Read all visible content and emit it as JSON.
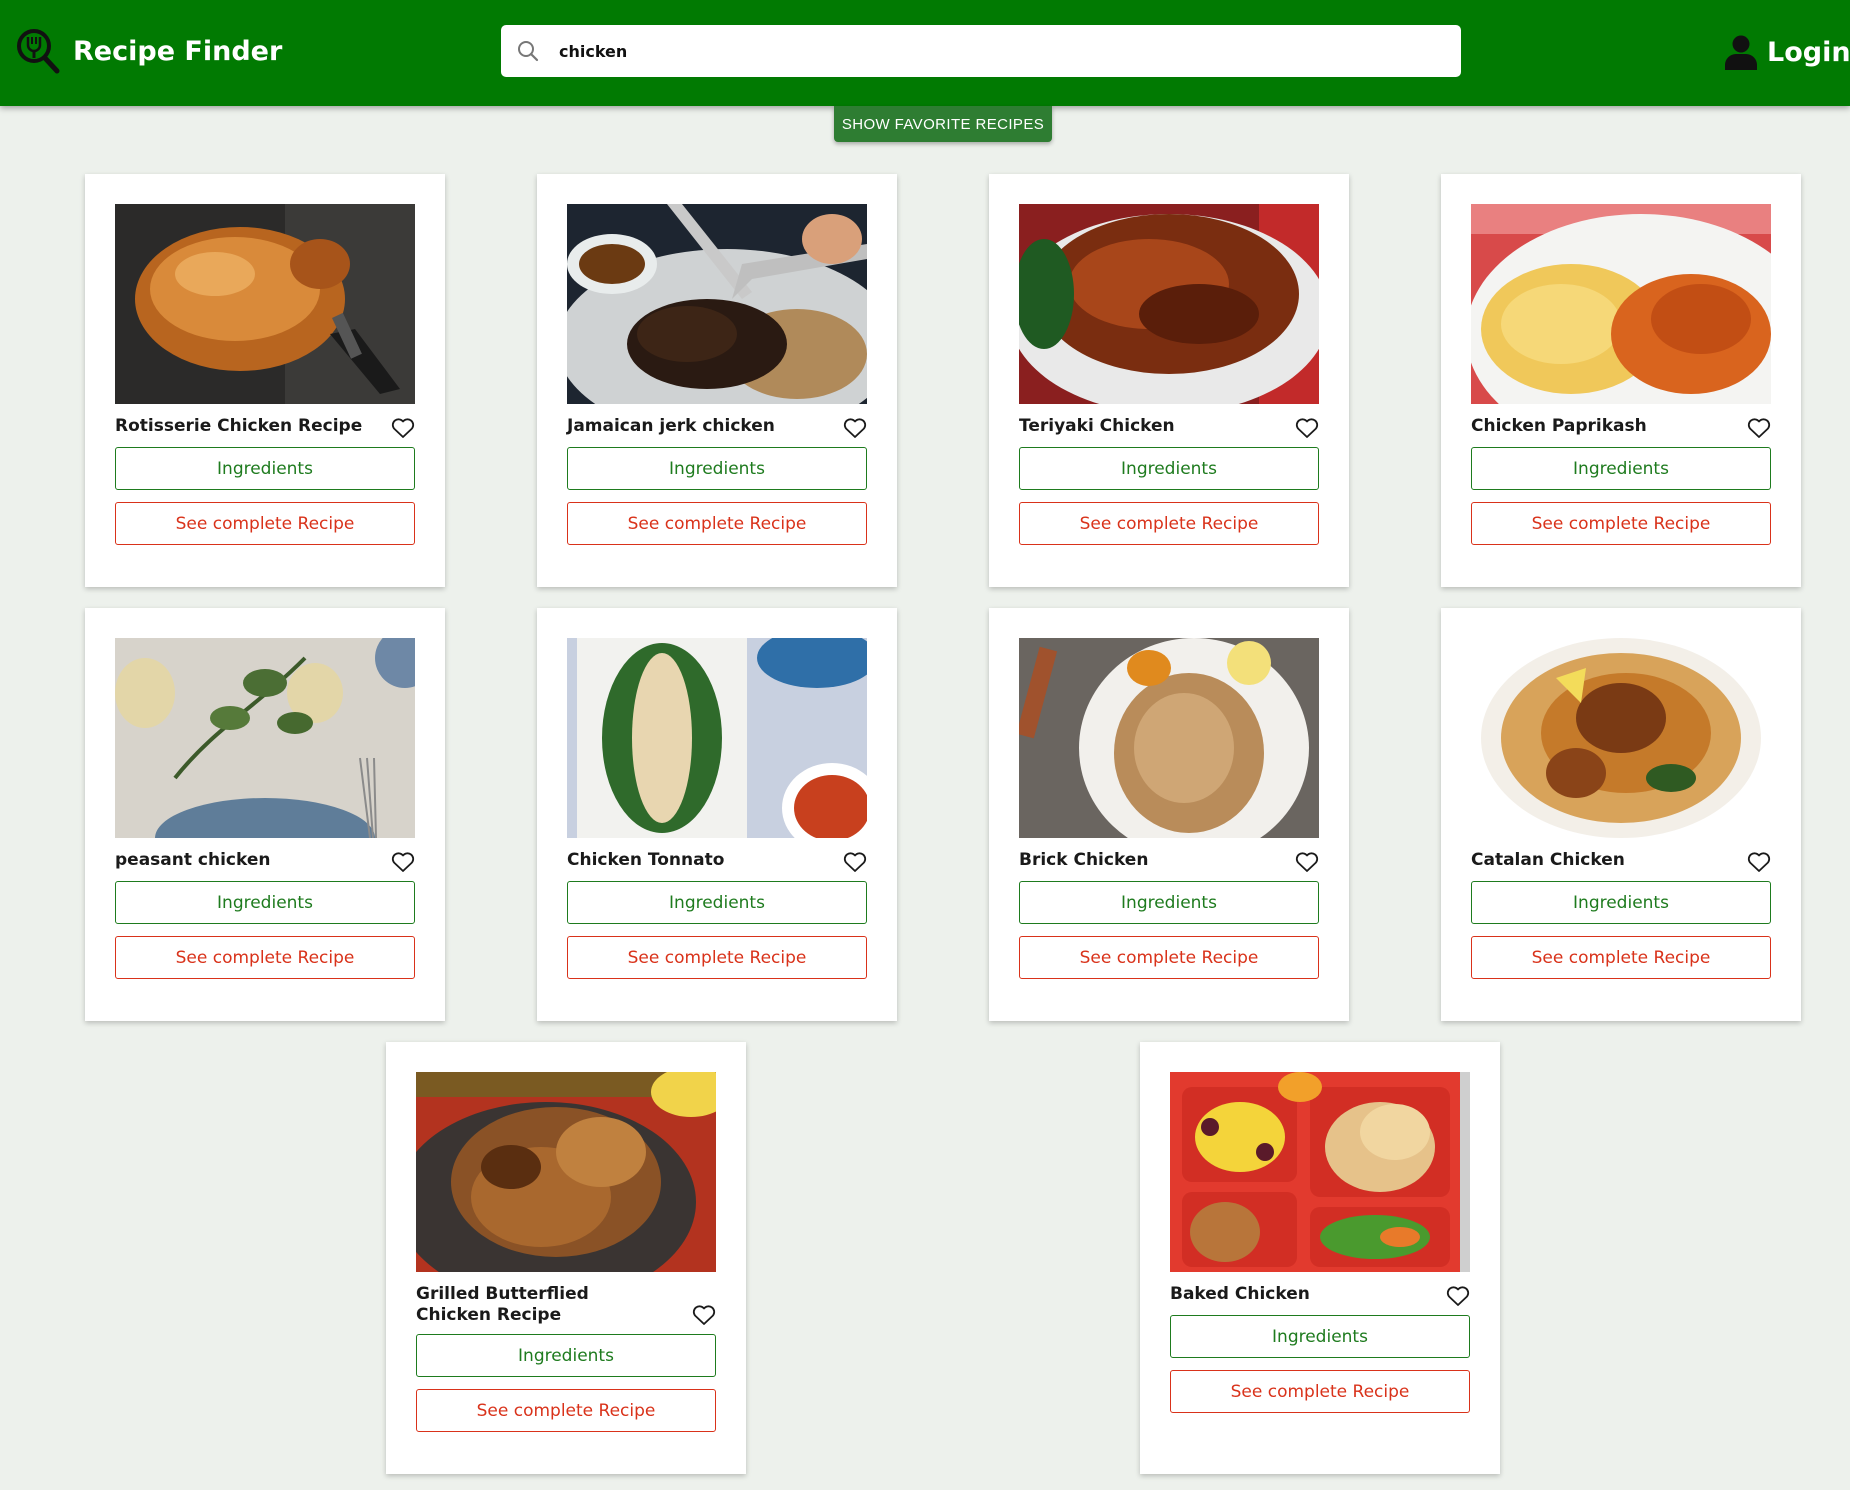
{
  "header": {
    "app_title": "Recipe Finder",
    "logo_icon": "fork-in-magnifier-icon",
    "search": {
      "value": "chicken",
      "icon": "search-icon"
    },
    "login_label": "Login",
    "login_icon": "user-icon",
    "background_color": "#017a02"
  },
  "favorites_button_label": "SHOW FAVORITE RECIPES",
  "colors": {
    "ingredients": "#1e7b1e",
    "recipe": "#d9321a",
    "page_background": "#edf1ec"
  },
  "recipes": [
    {
      "title": "Rotisserie Chicken Recipe",
      "ingredients_label": "Ingredients",
      "recipe_label": "See complete Recipe",
      "favorited": false
    },
    {
      "title": "Jamaican jerk chicken",
      "ingredients_label": "Ingredients",
      "recipe_label": "See complete Recipe",
      "favorited": false
    },
    {
      "title": "Teriyaki Chicken",
      "ingredients_label": "Ingredients",
      "recipe_label": "See complete Recipe",
      "favorited": false
    },
    {
      "title": "Chicken Paprikash",
      "ingredients_label": "Ingredients",
      "recipe_label": "See complete Recipe",
      "favorited": false
    },
    {
      "title": "peasant chicken",
      "ingredients_label": "Ingredients",
      "recipe_label": "See complete Recipe",
      "favorited": false
    },
    {
      "title": "Chicken Tonnato",
      "ingredients_label": "Ingredients",
      "recipe_label": "See complete Recipe",
      "favorited": false
    },
    {
      "title": "Brick Chicken",
      "ingredients_label": "Ingredients",
      "recipe_label": "See complete Recipe",
      "favorited": false
    },
    {
      "title": "Catalan Chicken",
      "ingredients_label": "Ingredients",
      "recipe_label": "See complete Recipe",
      "favorited": false
    },
    {
      "title": "Grilled Butterflied Chicken Recipe",
      "ingredients_label": "Ingredients",
      "recipe_label": "See complete Recipe",
      "favorited": false
    },
    {
      "title": "Baked Chicken",
      "ingredients_label": "Ingredients",
      "recipe_label": "See complete Recipe",
      "favorited": false
    }
  ]
}
